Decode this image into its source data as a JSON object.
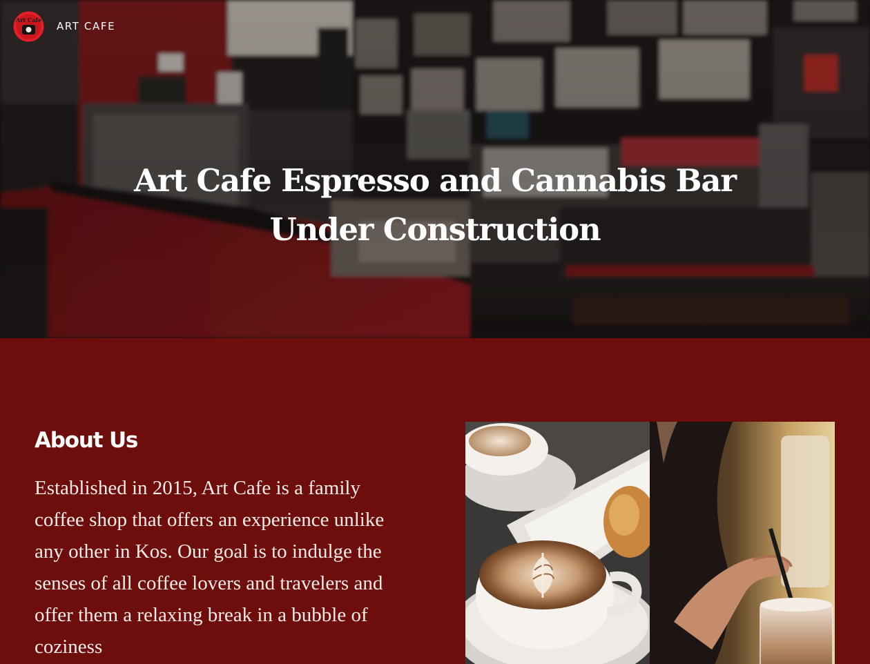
{
  "header": {
    "brand_name": "ART CAFE",
    "logo_icon": "art-cafe-logo-icon"
  },
  "hero": {
    "title_line1": "Art Cafe Espresso and Cannabis Bar",
    "title_line2": "Under Construction"
  },
  "about": {
    "heading": "About Us",
    "body": "Established in 2015, Art Cafe is a family coffee shop that offers an experience unlike any other in Kos. Our goal is to indulge the senses of all coffee lovers and travelers and offer them a relaxing break in a bubble of coziness"
  },
  "colors": {
    "section_background": "#6e0e0c",
    "logo_red": "#e3202a",
    "text_white": "#ffffff"
  }
}
